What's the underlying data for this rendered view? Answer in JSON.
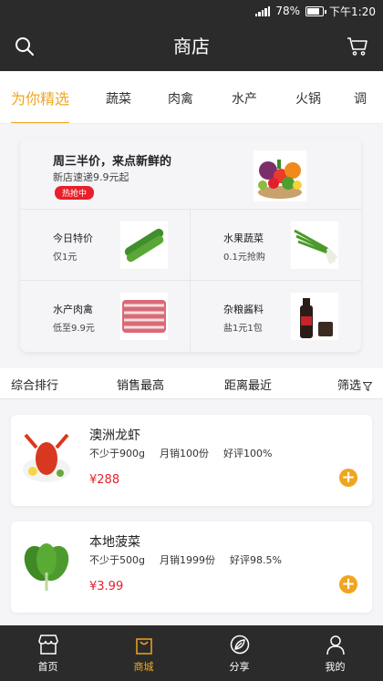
{
  "status": {
    "battery": "78%",
    "time": "下午1:20",
    "battery_level": 0.78
  },
  "header": {
    "title": "商店",
    "search_icon": "search-icon",
    "cart_icon": "cart-icon"
  },
  "tabs": [
    {
      "label": "为你精选",
      "active": true
    },
    {
      "label": "蔬菜"
    },
    {
      "label": "肉禽"
    },
    {
      "label": "水产"
    },
    {
      "label": "火锅"
    },
    {
      "label": "调"
    }
  ],
  "promo": {
    "headline": "周三半价，来点新鲜的",
    "subline": "新店速递9.9元起",
    "badge": "热抢中",
    "cells": [
      {
        "title": "今日特价",
        "sub": "仅1元"
      },
      {
        "title": "水果蔬菜",
        "sub": "0.1元抢购"
      },
      {
        "title": "水产肉禽",
        "sub": "低至9.9元"
      },
      {
        "title": "杂粮酱料",
        "sub": "盐1元1包"
      }
    ]
  },
  "sort": {
    "comprehensive": "综合排行",
    "sales": "销售最高",
    "distance": "距离最近",
    "filter": "筛选"
  },
  "products": [
    {
      "name": "澳洲龙虾",
      "min": "不少于900g",
      "sales": "月销100份",
      "rating": "好评100%",
      "price": "¥288"
    },
    {
      "name": "本地菠菜",
      "min": "不少于500g",
      "sales": "月销1999份",
      "rating": "好评98.5%",
      "price": "¥3.99"
    }
  ],
  "nav": [
    {
      "label": "首页"
    },
    {
      "label": "商城",
      "active": true
    },
    {
      "label": "分享"
    },
    {
      "label": "我的"
    }
  ],
  "colors": {
    "accent": "#f0a521",
    "dark": "#2b2b2b",
    "price": "#e8202b"
  }
}
